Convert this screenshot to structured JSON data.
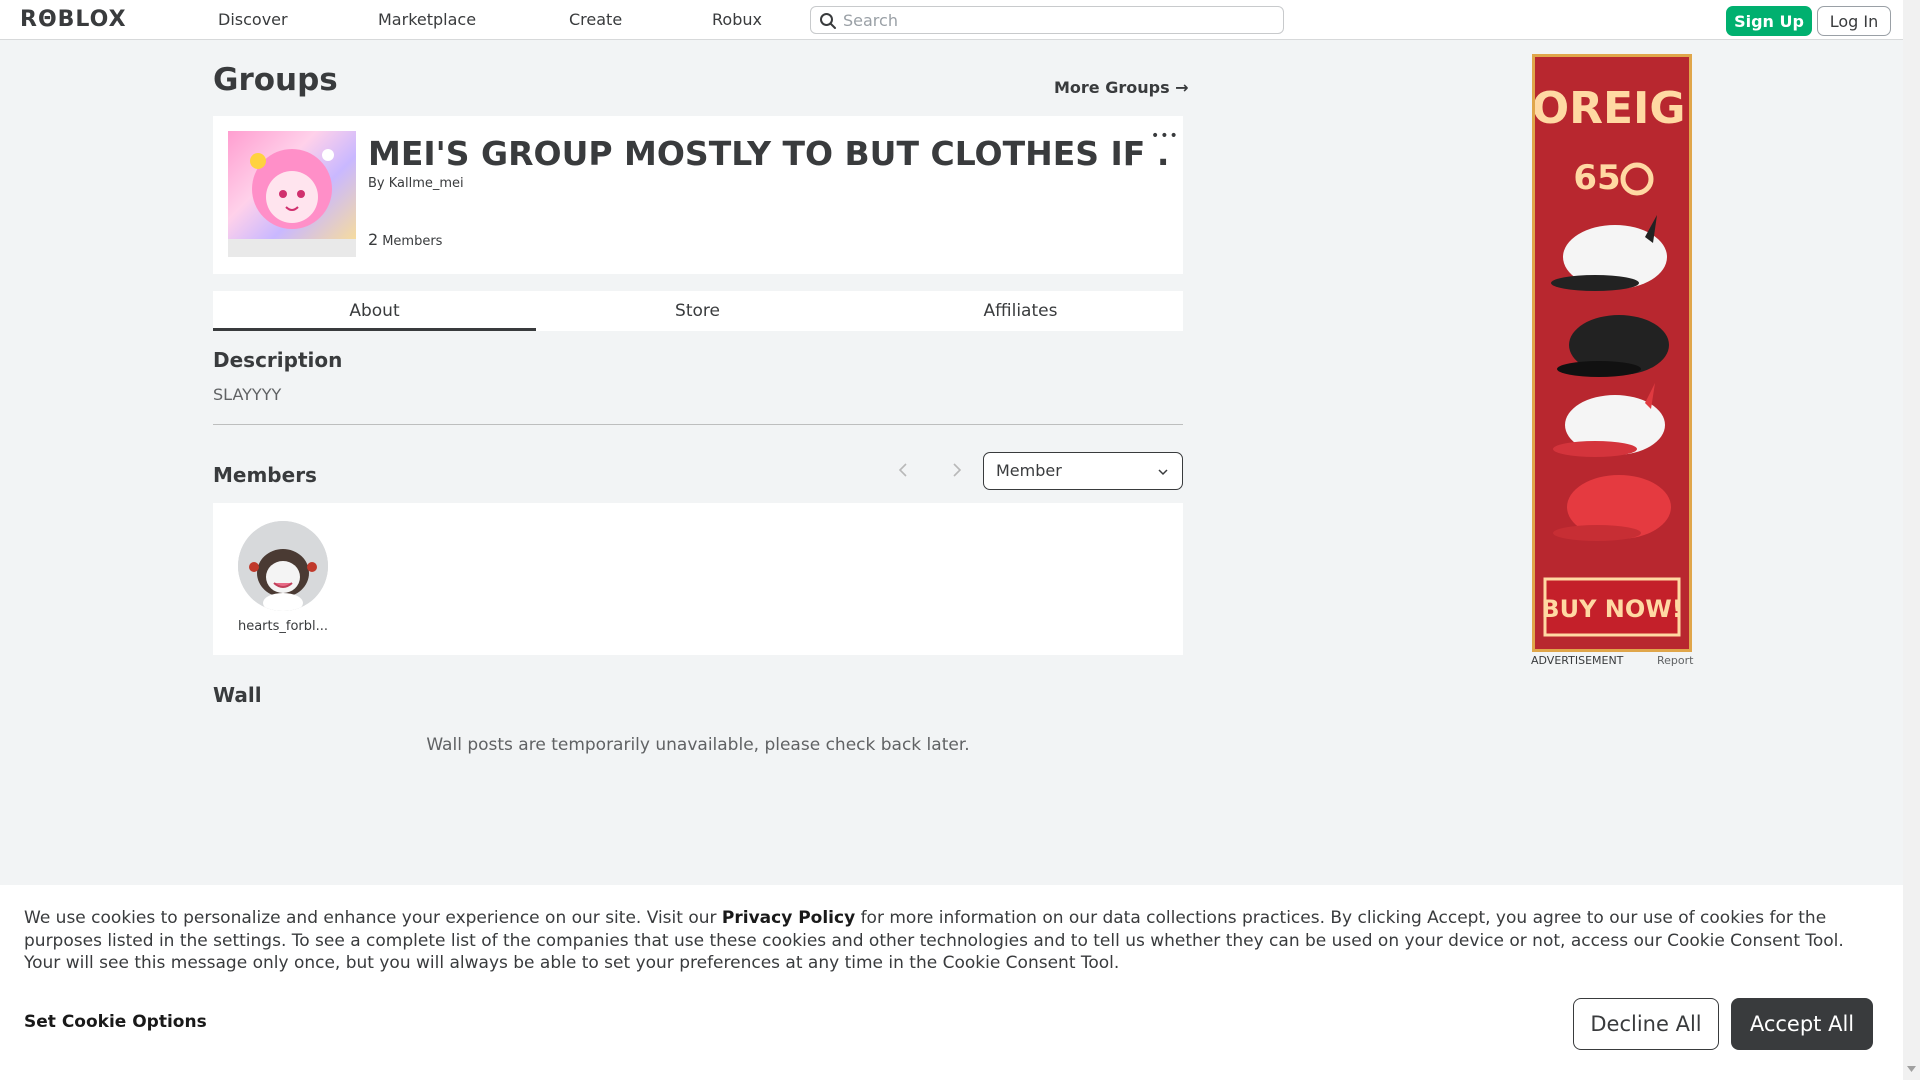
{
  "nav": {
    "logo": "RΘBLOX",
    "links": [
      "Discover",
      "Marketplace",
      "Create",
      "Robux"
    ],
    "search_placeholder": "Search",
    "signup_label": "Sign Up",
    "login_label": "Log In"
  },
  "page": {
    "title": "Groups",
    "more_groups": "More Groups →"
  },
  "group": {
    "name": "MEI'S GROUP MOSTLY TO BUT CLOTHES IF ...",
    "by_prefix": "By ",
    "owner": "Kallme_mei",
    "member_count": "2",
    "members_label": "Members",
    "menu": "•••"
  },
  "tabs": [
    {
      "label": "About",
      "active": true
    },
    {
      "label": "Store",
      "active": false
    },
    {
      "label": "Affiliates",
      "active": false
    }
  ],
  "about": {
    "description_heading": "Description",
    "description": "SLAYYYY",
    "members_heading": "Members",
    "role_selected": "Member",
    "members": [
      {
        "name": "hearts_forbl..."
      }
    ],
    "wall_heading": "Wall",
    "wall_message": "Wall posts are temporarily unavailable, please check back later."
  },
  "ad": {
    "headline": "FOREIGN",
    "price": "65",
    "cta": "BUY NOW!",
    "label": "ADVERTISEMENT",
    "report": "Report"
  },
  "cookie": {
    "text_1": "We use cookies to personalize and enhance your experience on our site. Visit our ",
    "privacy_link": "Privacy Policy",
    "text_2": " for more information on our data collections practices. By clicking Accept, you agree to our use of cookies for the purposes listed in the settings. To see a complete list of the companies that use these cookies and other technologies and to tell us whether they can be used on your device or not, access our Cookie Consent Tool. Your will see this message only once, but you will always be able to set your preferences at any time in the Cookie Consent Tool.",
    "set_options": "Set Cookie Options",
    "decline": "Decline All",
    "accept": "Accept All"
  },
  "colors": {
    "accent_green": "#00b06f",
    "text_dark": "#393b3d",
    "background": "#f2f4f5",
    "ad_red": "#b8272f"
  }
}
